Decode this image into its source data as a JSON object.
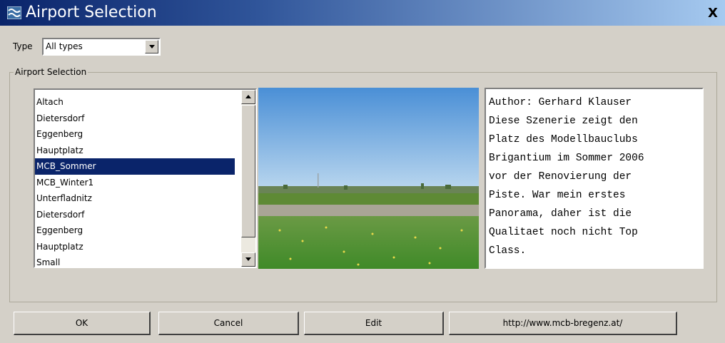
{
  "window": {
    "title": "Airport Selection",
    "close_label": "X"
  },
  "type_filter": {
    "label": "Type",
    "value": "All types"
  },
  "group": {
    "label": "Airport Selection"
  },
  "airports": {
    "items": [
      "Altach",
      "Dietersdorf",
      "Eggenberg",
      "Hauptplatz",
      "MCB_Sommer",
      "MCB_Winter1",
      "Unterfladnitz",
      "Dietersdorf",
      "Eggenberg",
      "Hauptplatz",
      "Small"
    ],
    "selected_index": 4
  },
  "description": "Author: Gerhard Klauser\nDiese Szenerie zeigt den\nPlatz des Modellbauclubs\nBrigantium im Sommer 2006\nvor der Renovierung der\nPiste. War mein erstes\nPanorama, daher ist die\nQualitaet noch nicht Top\nClass.",
  "buttons": {
    "ok": "OK",
    "cancel": "Cancel",
    "edit": "Edit",
    "website": "http://www.mcb-bregenz.at/"
  },
  "colors": {
    "titlebar_start": "#0a246a",
    "titlebar_end": "#a6caf0",
    "selection": "#0a246a",
    "dialog_bg": "#d4d0c8"
  },
  "icons": {
    "app": "app-icon",
    "close": "close-icon",
    "dropdown": "chevron-down-icon",
    "scroll_up": "scroll-up-icon",
    "scroll_down": "scroll-down-icon"
  }
}
